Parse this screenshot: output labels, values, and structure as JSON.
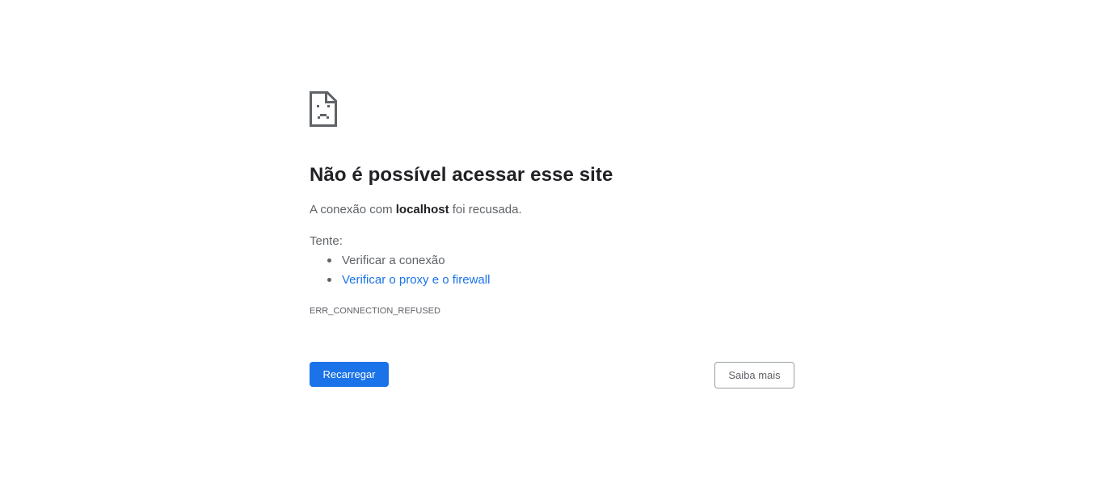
{
  "error_page": {
    "icon": "sad-document-icon",
    "title": "Não é possível acessar esse site",
    "description_prefix": "A conexão com ",
    "host": "localhost",
    "description_suffix": " foi recusada.",
    "try_label": "Tente:",
    "suggestions": [
      {
        "label": "Verificar a conexão",
        "link": false
      },
      {
        "label": "Verificar o proxy e o firewall",
        "link": true
      }
    ],
    "error_code": "ERR_CONNECTION_REFUSED",
    "reload_label": "Recarregar",
    "more_label": "Saiba mais"
  },
  "colors": {
    "accent": "#1a73e8",
    "title": "#202124",
    "text": "#5f6368",
    "icon": "#5f6368",
    "outline": "#9aa0a6"
  }
}
